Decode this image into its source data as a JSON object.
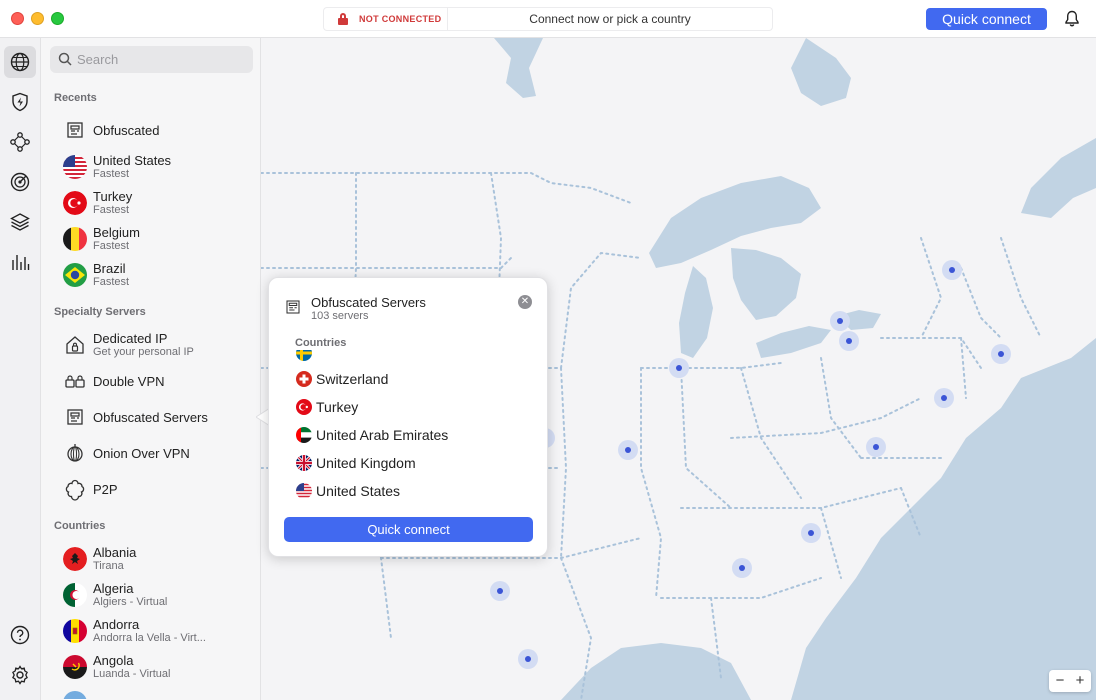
{
  "titlebar": {
    "status": "NOT CONNECTED",
    "hint": "Connect now or pick a country",
    "quick_connect": "Quick connect"
  },
  "rail": {
    "icons": [
      "globe-icon",
      "shield-bolt-icon",
      "meshnet-icon",
      "target-icon",
      "layers-icon",
      "stats-icon",
      "help-icon",
      "settings-icon"
    ]
  },
  "sidebar": {
    "search_placeholder": "Search",
    "recents_title": "Recents",
    "recents": [
      {
        "label": "Obfuscated",
        "sub": ""
      },
      {
        "label": "United States",
        "sub": "Fastest"
      },
      {
        "label": "Turkey",
        "sub": "Fastest"
      },
      {
        "label": "Belgium",
        "sub": "Fastest"
      },
      {
        "label": "Brazil",
        "sub": "Fastest"
      }
    ],
    "specialty_title": "Specialty Servers",
    "specialty": [
      {
        "label": "Dedicated IP",
        "sub": "Get your personal IP"
      },
      {
        "label": "Double VPN",
        "sub": ""
      },
      {
        "label": "Obfuscated Servers",
        "sub": ""
      },
      {
        "label": "Onion Over VPN",
        "sub": ""
      },
      {
        "label": "P2P",
        "sub": ""
      }
    ],
    "countries_title": "Countries",
    "countries": [
      {
        "label": "Albania",
        "sub": "Tirana"
      },
      {
        "label": "Algeria",
        "sub": "Algiers - Virtual"
      },
      {
        "label": "Andorra",
        "sub": "Andorra la Vella - Virt..."
      },
      {
        "label": "Angola",
        "sub": "Luanda - Virtual"
      }
    ]
  },
  "popover": {
    "title": "Obfuscated Servers",
    "subtitle": "103 servers",
    "countries_title": "Countries",
    "countries": [
      "Switzerland",
      "Turkey",
      "United Arab Emirates",
      "United Kingdom",
      "United States"
    ],
    "quick_connect": "Quick connect"
  },
  "zoom": {
    "minus": "−",
    "plus": "+"
  },
  "colors": {
    "accent": "#4169f0",
    "danger": "#d03a3a",
    "water": "#c1d3e3",
    "dot": "#3b55d6"
  }
}
